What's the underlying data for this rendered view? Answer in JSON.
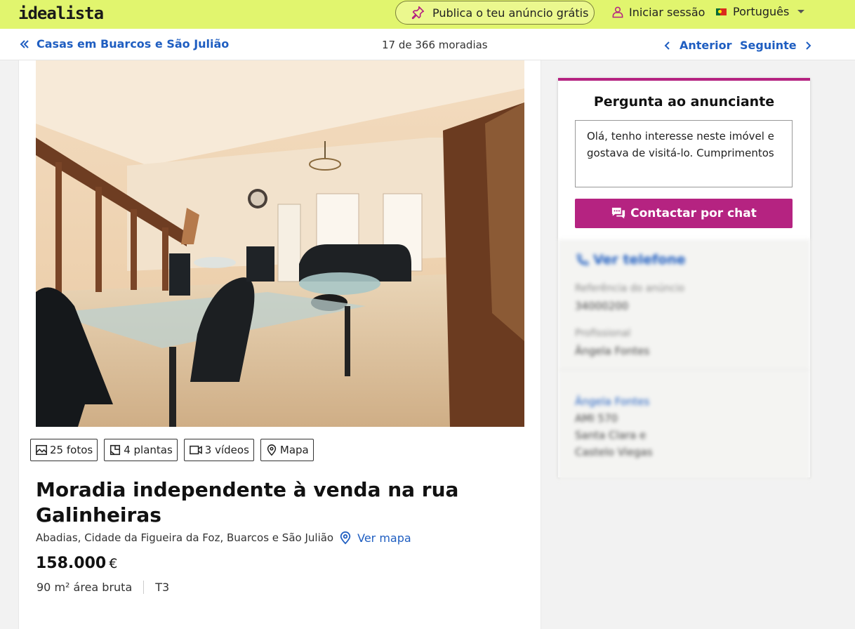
{
  "header": {
    "logo": "idealista",
    "publish_label": "Publica o teu anúncio grátis",
    "login_label": "Iniciar sessão",
    "language_label": "Português"
  },
  "subnav": {
    "back_label": "Casas em Buarcos e São Julião",
    "counter": "17 de 366 moradias",
    "prev_label": "Anterior",
    "next_label": "Seguinte"
  },
  "listing": {
    "media": {
      "photos": "25 fotos",
      "plans": "4 plantas",
      "videos": "3 vídeos",
      "map": "Mapa"
    },
    "title": "Moradia independente à venda na rua Galinheiras",
    "address": "Abadias, Cidade da Figueira da Foz, Buarcos e São Julião",
    "map_link": "Ver mapa",
    "price": "158.000",
    "currency": "€",
    "area": "90 m² área bruta",
    "typology": "T3"
  },
  "contact": {
    "title": "Pergunta ao anunciante",
    "message": "Olá, tenho interesse neste imóvel e gostava de visitá-lo. Cumprimentos",
    "chat_label": "Contactar por chat",
    "phone_label": "Ver telefone",
    "ref_label": "Referência do anúncio",
    "ref_value": "34000200",
    "professional_label": "Profissional",
    "professional_value": "Ângela Fontes",
    "agent_name": "Ângela Fontes",
    "agent_line1": "AMI 570",
    "agent_line2": "Santa Clara e",
    "agent_line3": "Castelo Viegas"
  },
  "colors": {
    "header_bg": "#e1f56e",
    "link_blue": "#1f5ec1",
    "accent_magenta": "#b52381"
  }
}
